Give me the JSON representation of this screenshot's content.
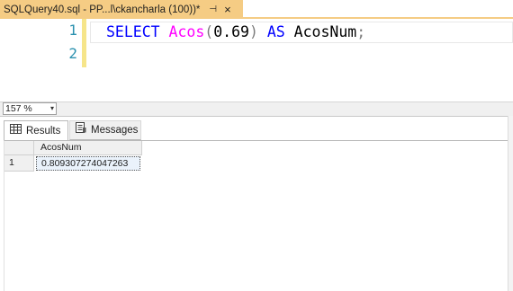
{
  "document_tab": {
    "title": "SQLQuery40.sql - PP...l\\ckancharla (100))*",
    "pin_glyph": "⊣",
    "close_glyph": "×"
  },
  "editor": {
    "line_numbers": [
      "1",
      "2"
    ],
    "code": {
      "select_kw": "SELECT",
      "function_name": "Acos",
      "open_paren": "(",
      "argument": "0.69",
      "close_paren": ")",
      "as_kw": "AS",
      "alias": "AcosNum",
      "terminator": ";"
    }
  },
  "status": {
    "zoom_value": "157 %",
    "zoom_chevron": "▾"
  },
  "results_tabs": {
    "results_label": "Results",
    "messages_label": "Messages"
  },
  "grid": {
    "columns": [
      "AcosNum"
    ],
    "rows": [
      {
        "row_number": "1",
        "values": [
          "0.809307274047263"
        ]
      }
    ]
  },
  "colors": {
    "tab_accent": "#f5cc84",
    "keyword": "#0000ff",
    "function": "#ff00ff",
    "line_number": "#2b91af",
    "change_bar": "#f6e58a"
  },
  "icons": {
    "grid_tab_icon": "grid-icon",
    "messages_tab_icon": "messages-icon",
    "pin_icon": "pin-icon",
    "close_icon": "close-icon"
  }
}
